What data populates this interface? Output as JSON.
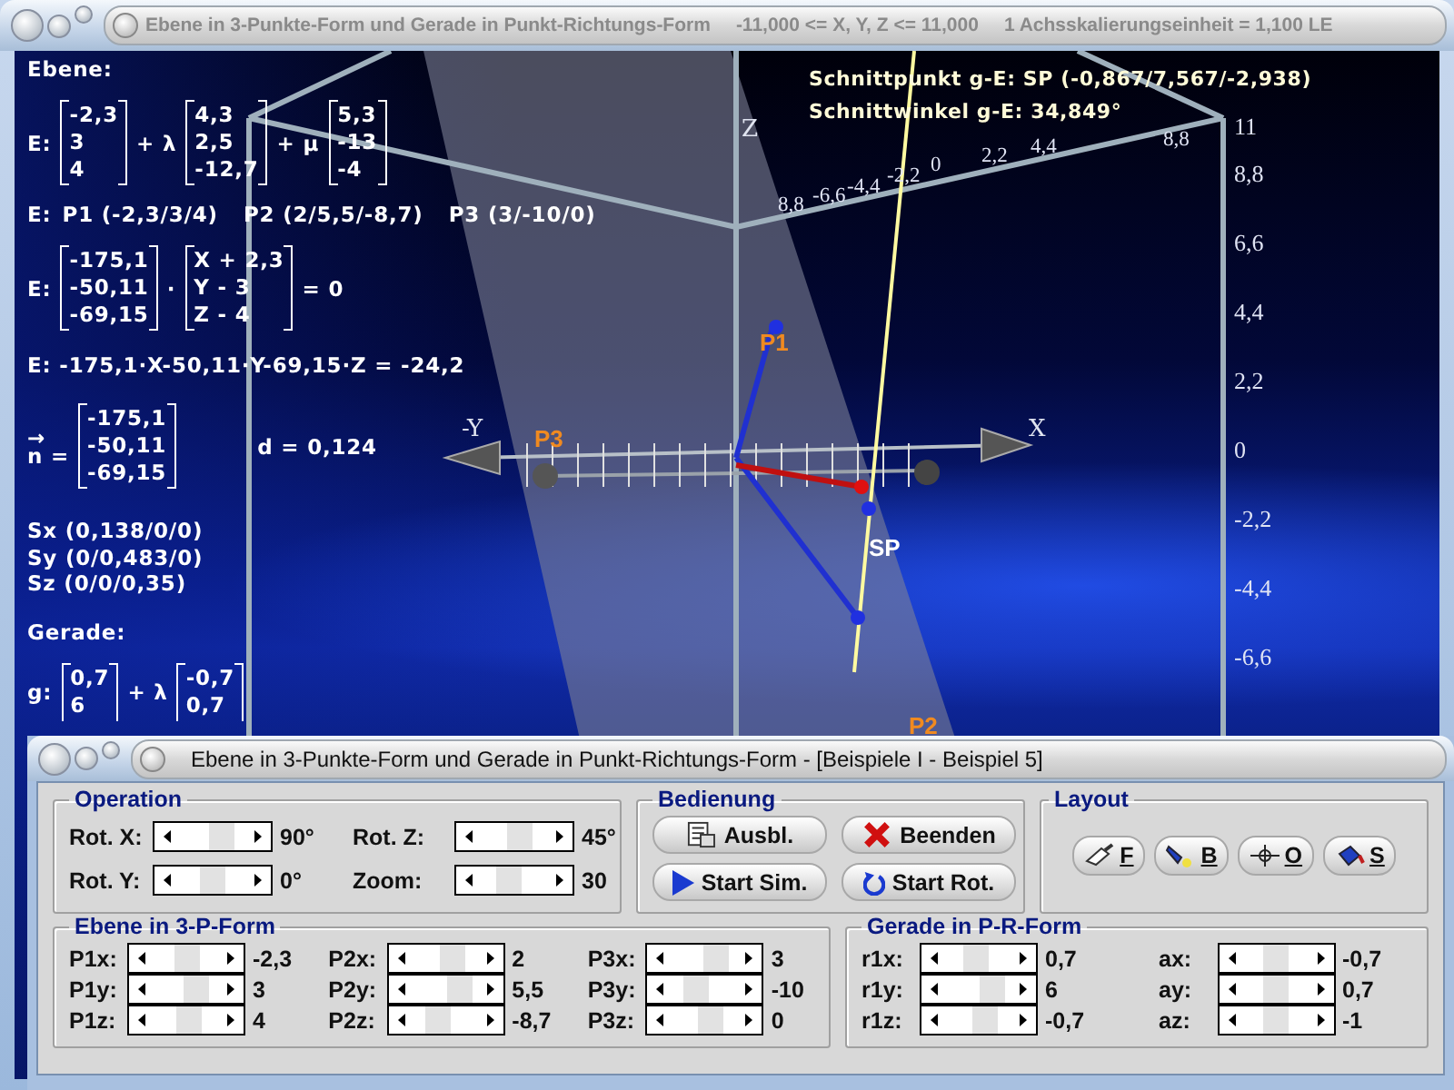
{
  "window": {
    "title": "Ebene in 3-Punkte-Form und Gerade in Punkt-Richtungs-Form",
    "range": "-11,000 <= X, Y, Z <= 11,000",
    "scale": "1 Achsskalierungseinheit = 1,100 LE"
  },
  "overlay": {
    "plane_heading": "Ebene:",
    "param_form": {
      "label": "E:",
      "support": [
        "-2,3",
        "3",
        "4"
      ],
      "lambda": "+ λ",
      "dir1": [
        "4,3",
        "2,5",
        "-12,7"
      ],
      "mu": "+ μ",
      "dir2": [
        "5,3",
        "-13",
        "-4"
      ]
    },
    "points_label": "E:",
    "points": [
      "P1 (-2,3/3/4)",
      "P2 (2/5,5/-8,7)",
      "P3 (3/-10/0)"
    ],
    "normal_form": {
      "label": "E:",
      "normal": [
        "-175,1",
        "-50,11",
        "-69,15"
      ],
      "dot": "·",
      "position": [
        "X + 2,3",
        "Y - 3",
        "Z - 4"
      ],
      "rhs": "= 0"
    },
    "coord_form": "E: -175,1·X-50,11·Y-69,15·Z = -24,2",
    "normal_vector": {
      "arrow": "→",
      "label": "n =",
      "values": [
        "-175,1",
        "-50,11",
        "-69,15"
      ],
      "distance": "d = 0,124"
    },
    "intercepts": [
      "Sx (0,138/0/0)",
      "Sy (0/0,483/0)",
      "Sz (0/0/0,35)"
    ],
    "line_heading": "Gerade:",
    "line_form": {
      "label": "g:",
      "support": [
        "0,7",
        "6"
      ],
      "lambda": "+ λ",
      "direction": [
        "-0,7",
        "0,7"
      ]
    },
    "intersection_point": "Schnittpunkt g-E: SP (-0,867/7,567/-2,938)",
    "intersection_angle": "Schnittwinkel g-E: 34,849°"
  },
  "scene": {
    "x_axis_label": "X",
    "y_axis_label": "-Y",
    "z_axis_label": "Z",
    "points": [
      "P1",
      "P2",
      "P3"
    ],
    "intersection_label": "SP",
    "vertical_scale": [
      "11",
      "8,8",
      "6,6",
      "4,4",
      "2,2",
      "0",
      "-2,2",
      "-4,4",
      "-6,6"
    ],
    "oblique_scale": [
      "8,8",
      "-6,6",
      "-4,4",
      "-2,2",
      "0",
      "2,2",
      "4,4",
      "8,8"
    ]
  },
  "dialog": {
    "title": "Ebene in 3-Punkte-Form und Gerade in Punkt-Richtungs-Form - [Beispiele I - Beispiel 5]",
    "operation": {
      "title": "Operation",
      "sliders": [
        {
          "label": "Rot. X:",
          "level": 0.65,
          "value": "90°"
        },
        {
          "label": "Rot. Z:",
          "level": 0.58,
          "value": "45°"
        },
        {
          "label": "Rot. Y:",
          "level": 0.5,
          "value": "0°"
        },
        {
          "label": "Zoom:",
          "level": 0.42,
          "value": "30"
        }
      ]
    },
    "controls": {
      "title": "Bedienung",
      "buttons": [
        {
          "label": "Ausbl.",
          "kind": "hide"
        },
        {
          "label": "Beenden",
          "kind": "exit"
        },
        {
          "label": "Start Sim.",
          "kind": "play"
        },
        {
          "label": "Start Rot.",
          "kind": "rotate"
        }
      ]
    },
    "layout": {
      "title": "Layout",
      "buttons": [
        {
          "label": "F",
          "kind": "brush"
        },
        {
          "label": "B",
          "kind": "flashlight"
        },
        {
          "label": "O",
          "kind": "crosshair"
        },
        {
          "label": "S",
          "kind": "bucket"
        }
      ]
    },
    "plane_points": {
      "title": "Ebene in 3-P-Form",
      "sliders": [
        {
          "label": "P1x:",
          "level": 0.52,
          "value": "-2,3"
        },
        {
          "label": "P1y:",
          "level": 0.67,
          "value": "3"
        },
        {
          "label": "P1z:",
          "level": 0.55,
          "value": "4"
        },
        {
          "label": "P2x:",
          "level": 0.62,
          "value": "2"
        },
        {
          "label": "P2y:",
          "level": 0.72,
          "value": "5,5"
        },
        {
          "label": "P2z:",
          "level": 0.37,
          "value": "-8,7"
        },
        {
          "label": "P3x:",
          "level": 0.67,
          "value": "3"
        },
        {
          "label": "P3y:",
          "level": 0.36,
          "value": "-10"
        },
        {
          "label": "P3z:",
          "level": 0.6,
          "value": "0"
        }
      ]
    },
    "line": {
      "title": "Gerade in P-R-Form",
      "sliders": [
        {
          "label": "r1x:",
          "level": 0.45,
          "value": "0,7"
        },
        {
          "label": "r1y:",
          "level": 0.7,
          "value": "6"
        },
        {
          "label": "r1z:",
          "level": 0.6,
          "value": "-0,7"
        },
        {
          "label": "ax:",
          "level": 0.5,
          "value": "-0,7"
        },
        {
          "label": "ay:",
          "level": 0.5,
          "value": "0,7"
        },
        {
          "label": "az:",
          "level": 0.5,
          "value": "-1"
        }
      ]
    }
  }
}
